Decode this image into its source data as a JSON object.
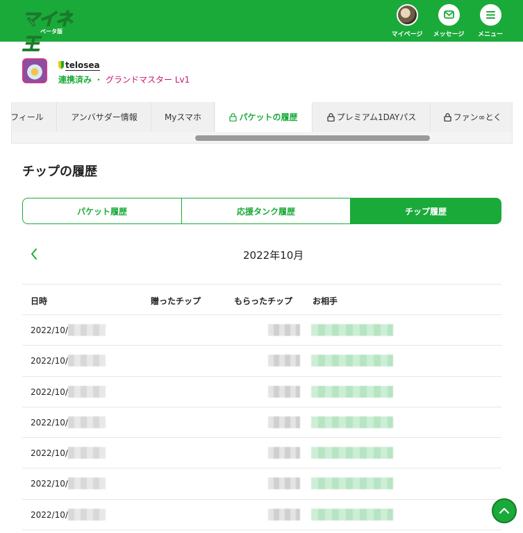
{
  "header": {
    "logo_text": "マイネ王",
    "logo_sub": "ベータ版",
    "nav": [
      {
        "label": "マイページ",
        "icon": "avatar-icon"
      },
      {
        "label": "メッセージ",
        "icon": "envelope-icon"
      },
      {
        "label": "メニュー",
        "icon": "hamburger-icon"
      }
    ],
    "brand_color": "#1aaa3a"
  },
  "profile": {
    "username": "telosea",
    "status_linked": "連携済み",
    "separator": "・",
    "rank": "グランドマスター Lv1"
  },
  "tabs": [
    {
      "label": "フィール",
      "locked": false,
      "active": false
    },
    {
      "label": "アンバサダー情報",
      "locked": false,
      "active": false
    },
    {
      "label": "Myスマホ",
      "locked": false,
      "active": false
    },
    {
      "label": "パケットの履歴",
      "locked": true,
      "active": true
    },
    {
      "label": "プレミアム1DAYパス",
      "locked": true,
      "active": false
    },
    {
      "label": "ファン∞とく",
      "locked": true,
      "active": false
    }
  ],
  "section_title": "チップの履歴",
  "segments": [
    {
      "label": "パケット履歴",
      "active": false
    },
    {
      "label": "応援タンク履歴",
      "active": false
    },
    {
      "label": "チップ履歴",
      "active": true
    }
  ],
  "month": {
    "label": "2022年10月"
  },
  "table": {
    "headers": [
      "日時",
      "贈ったチップ",
      "もらったチップ",
      "お相手"
    ],
    "rows": [
      {
        "date": "2022/10/"
      },
      {
        "date": "2022/10/"
      },
      {
        "date": "2022/10/"
      },
      {
        "date": "2022/10/"
      },
      {
        "date": "2022/10/"
      },
      {
        "date": "2022/10/"
      },
      {
        "date": "2022/10/"
      }
    ]
  }
}
